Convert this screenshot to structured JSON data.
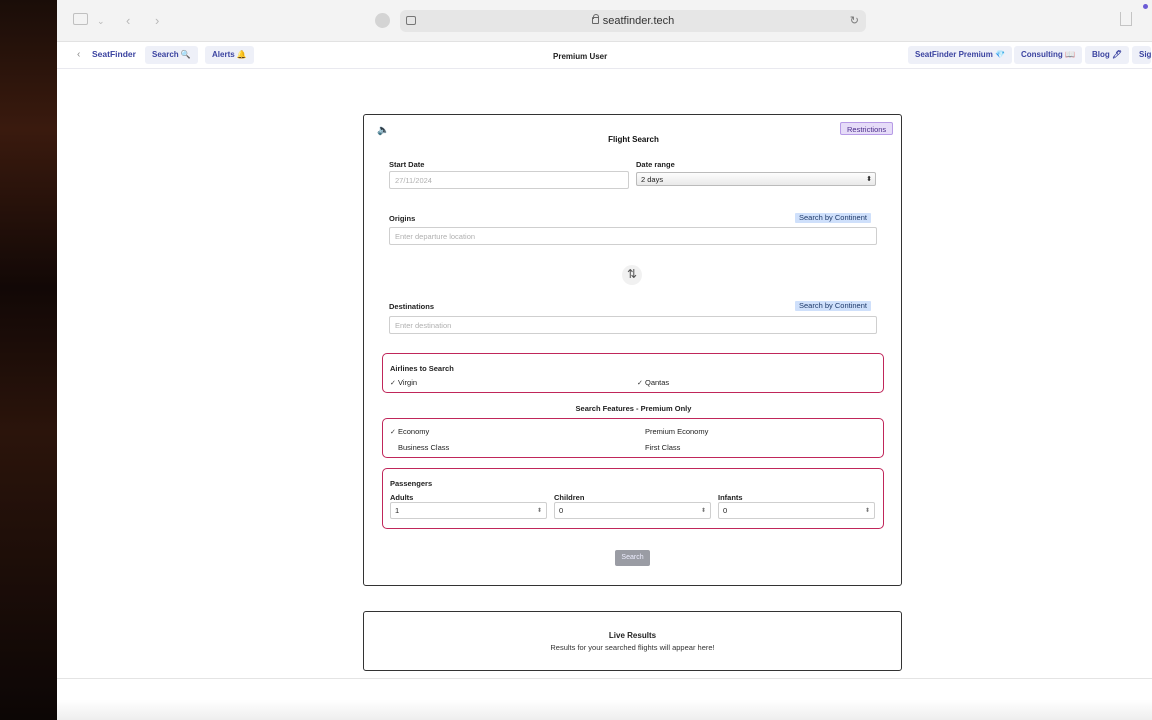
{
  "browser": {
    "url": "seatfinder.tech"
  },
  "nav": {
    "brand": "SeatFinder",
    "search": "Search 🔍",
    "alerts": "Alerts 🔔",
    "center_label": "Premium User",
    "premium": "SeatFinder Premium 💎",
    "consulting": "Consulting 📖",
    "blog": "Blog 🖊",
    "signin_partial": "Sig"
  },
  "form": {
    "restrictions": "Restrictions",
    "title": "Flight Search",
    "start_date_label": "Start Date",
    "start_date_value": "27/11/2024",
    "date_range_label": "Date range",
    "date_range_value": "2 days",
    "origins_label": "Origins",
    "origins_placeholder": "Enter departure location",
    "search_by_continent": "Search by Continent",
    "destinations_label": "Destinations",
    "destinations_placeholder": "Enter destination",
    "airlines_heading": "Airlines to Search",
    "airlines": [
      {
        "label": "Virgin",
        "checked": true
      },
      {
        "label": "Qantas",
        "checked": true
      }
    ],
    "features_heading": "Search Features - Premium Only",
    "cabins": [
      {
        "label": "Economy",
        "checked": true
      },
      {
        "label": "Premium Economy",
        "checked": false
      },
      {
        "label": "Business Class",
        "checked": false
      },
      {
        "label": "First Class",
        "checked": false
      }
    ],
    "passengers_heading": "Passengers",
    "adults_label": "Adults",
    "adults_value": "1",
    "children_label": "Children",
    "children_value": "0",
    "infants_label": "Infants",
    "infants_value": "0",
    "search_button": "Search"
  },
  "results": {
    "title": "Live Results",
    "message": "Results for your searched flights will appear here!"
  }
}
